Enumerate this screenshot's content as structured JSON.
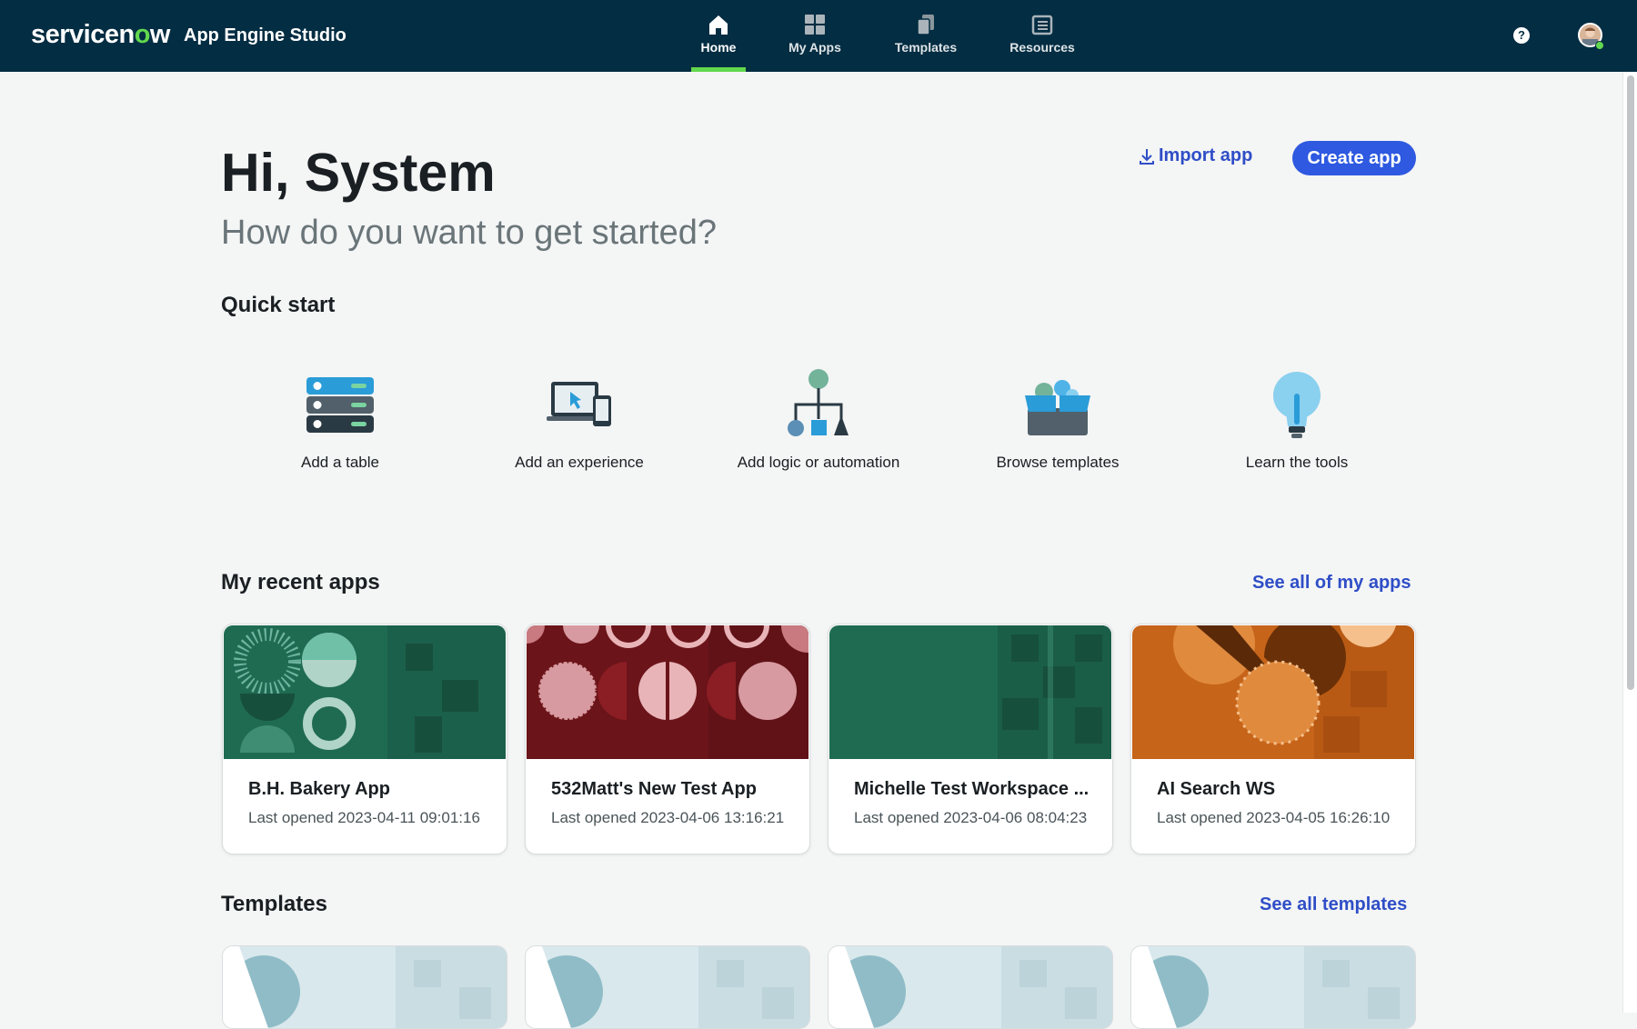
{
  "header": {
    "brand": "servicenow",
    "product": "App Engine Studio",
    "nav": [
      {
        "label": "Home",
        "icon": "home-icon",
        "active": true
      },
      {
        "label": "My Apps",
        "icon": "grid-icon",
        "active": false
      },
      {
        "label": "Templates",
        "icon": "templates-icon",
        "active": false
      },
      {
        "label": "Resources",
        "icon": "resources-icon",
        "active": false
      }
    ],
    "help_glyph": "?"
  },
  "hero": {
    "greeting": "Hi, System",
    "subtitle": "How do you want to get started?",
    "import_label": "Import app",
    "create_label": "Create app"
  },
  "quick_start": {
    "title": "Quick start",
    "items": [
      {
        "label": "Add a table",
        "icon": "table-icon"
      },
      {
        "label": "Add an experience",
        "icon": "experience-icon"
      },
      {
        "label": "Add logic or automation",
        "icon": "logic-icon"
      },
      {
        "label": "Browse templates",
        "icon": "templates-box-icon"
      },
      {
        "label": "Learn the tools",
        "icon": "lightbulb-icon"
      }
    ]
  },
  "recent_apps": {
    "title": "My recent apps",
    "see_all": "See all of my apps",
    "apps": [
      {
        "name": "B.H. Bakery App",
        "last_opened": "Last opened 2023-04-11 09:01:16",
        "color": "#1f6b52"
      },
      {
        "name": "532Matt's New Test App",
        "last_opened": "Last opened 2023-04-06 13:16:21",
        "color": "#6b1419"
      },
      {
        "name": "Michelle Test Workspace ...",
        "last_opened": "Last opened 2023-04-06 08:04:23",
        "color": "#1f6b52"
      },
      {
        "name": "AI Search WS",
        "last_opened": "Last opened 2023-04-05 16:26:10",
        "color": "#c66419"
      }
    ]
  },
  "templates": {
    "title": "Templates",
    "see_all": "See all templates"
  },
  "colors": {
    "header_bg": "#032d42",
    "accent_green": "#62d84e",
    "link_blue": "#2f4ec7",
    "button_blue": "#2e59e0"
  }
}
